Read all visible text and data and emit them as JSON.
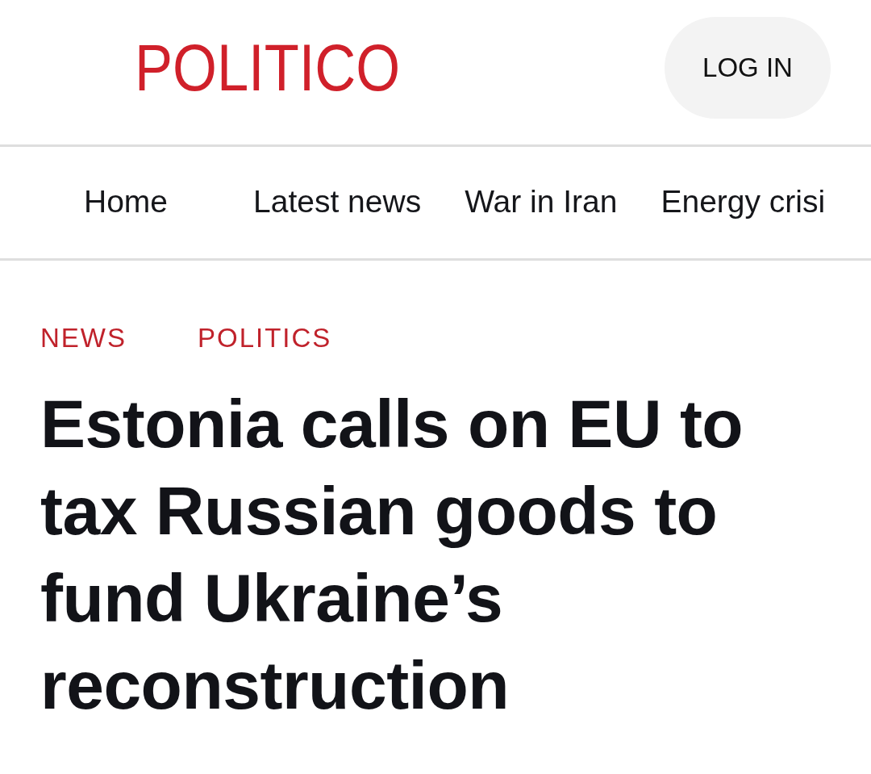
{
  "header": {
    "logo": "POLITICO",
    "login_button": "LOG IN"
  },
  "nav": {
    "items": [
      {
        "label": "Home"
      },
      {
        "label": "Latest news"
      },
      {
        "label": "War in Iran"
      },
      {
        "label": "Energy crisi"
      }
    ]
  },
  "article": {
    "kickers": [
      "NEWS",
      "POLITICS"
    ],
    "headline": "Estonia calls on EU to tax Russian goods to fund Ukraine’s reconstruction"
  }
}
